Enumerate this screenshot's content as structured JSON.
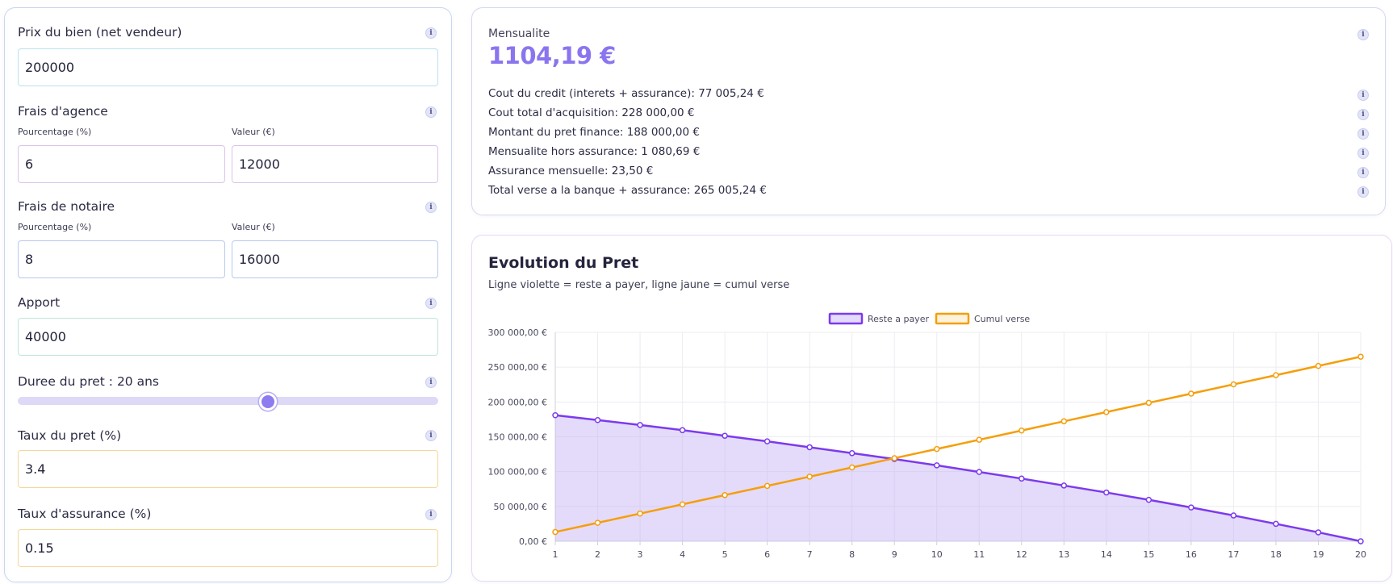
{
  "form": {
    "prix": {
      "label": "Prix du bien (net vendeur)",
      "value": "200000"
    },
    "frais_agence": {
      "label": "Frais d'agence",
      "pct_label": "Pourcentage (%)",
      "pct_value": "6",
      "val_label": "Valeur (€)",
      "val_value": "12000"
    },
    "frais_notaire": {
      "label": "Frais de notaire",
      "pct_label": "Pourcentage (%)",
      "pct_value": "8",
      "val_label": "Valeur (€)",
      "val_value": "16000"
    },
    "apport": {
      "label": "Apport",
      "value": "40000"
    },
    "duree": {
      "label": "Duree du pret : 20 ans",
      "years": 20,
      "min": 5,
      "max": 35
    },
    "taux_pret": {
      "label": "Taux du pret (%)",
      "value": "3.4"
    },
    "taux_assurance": {
      "label": "Taux d'assurance (%)",
      "value": "0.15"
    },
    "info_glyph": "i"
  },
  "summary": {
    "mensualite_label": "Mensualite",
    "mensualite_value": "1104,19 €",
    "lines": [
      "Cout du credit (interets + assurance): 77 005,24 €",
      "Cout total d'acquisition: 228 000,00 €",
      "Montant du pret finance: 188 000,00 €",
      "Mensualite hors assurance: 1 080,69 €",
      "Assurance mensuelle: 23,50 €",
      "Total verse a la banque + assurance: 265 005,24 €"
    ]
  },
  "chart": {
    "title": "Evolution du Pret",
    "subtitle": "Ligne violette = reste a payer, ligne jaune = cumul verse"
  },
  "chart_data": {
    "type": "line",
    "x": [
      1,
      2,
      3,
      4,
      5,
      6,
      7,
      8,
      9,
      10,
      11,
      12,
      13,
      14,
      15,
      16,
      17,
      18,
      19,
      20
    ],
    "ylim": [
      0,
      300000
    ],
    "yticks": [
      0,
      50000,
      100000,
      150000,
      200000,
      250000,
      300000
    ],
    "ytick_labels": [
      "0,00 €",
      "50 000,00 €",
      "100 000,00 €",
      "150 000,00 €",
      "200 000,00 €",
      "250 000,00 €",
      "300 000,00 €"
    ],
    "grid": true,
    "legend_position": "top-center",
    "series": [
      {
        "name": "Reste a payer",
        "color": "#7c3aed",
        "fill": "rgba(196,176,245,0.45)",
        "values": [
          181000,
          174000,
          167000,
          159500,
          151500,
          143500,
          135000,
          126500,
          118000,
          109000,
          99500,
          90000,
          80000,
          70000,
          59500,
          48500,
          37000,
          25000,
          12800,
          0
        ]
      },
      {
        "name": "Cumul verse",
        "color": "#f59e0b",
        "fill": "none",
        "values": [
          13250,
          26500,
          39750,
          53000,
          66250,
          79500,
          92750,
          106000,
          119250,
          132500,
          145750,
          159000,
          172250,
          185500,
          198750,
          212000,
          225250,
          238500,
          251750,
          265005
        ]
      }
    ]
  }
}
